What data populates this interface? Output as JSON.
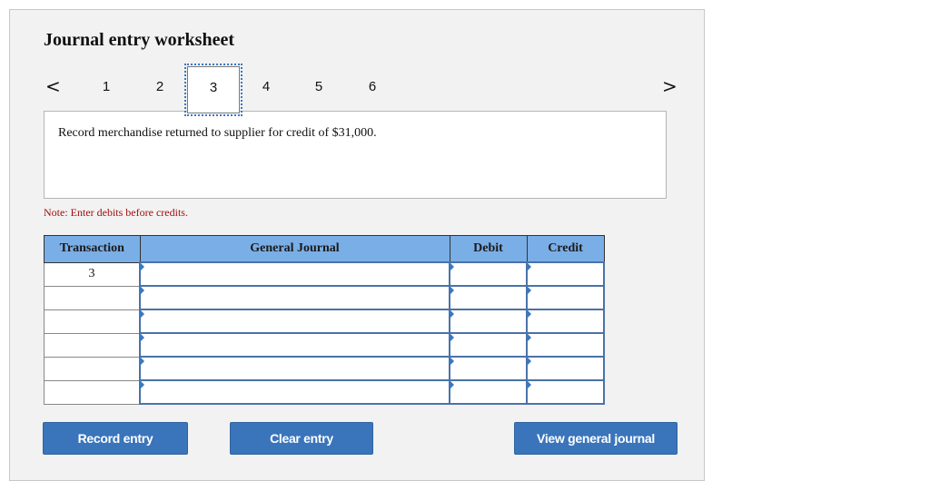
{
  "worksheet": {
    "title": "Journal entry worksheet",
    "nav": {
      "prev_icon": "‹",
      "next_icon": "›",
      "steps": [
        "1",
        "2",
        "3",
        "4",
        "5",
        "6"
      ],
      "active_step": "3"
    },
    "prompt": "Record merchandise returned to supplier for credit of $31,000.",
    "note": "Note: Enter debits before credits.",
    "table": {
      "headers": {
        "transaction": "Transaction",
        "general_journal": "General Journal",
        "debit": "Debit",
        "credit": "Credit"
      },
      "rows": [
        {
          "transaction": "3",
          "account": "",
          "debit": "",
          "credit": ""
        },
        {
          "transaction": "",
          "account": "",
          "debit": "",
          "credit": ""
        },
        {
          "transaction": "",
          "account": "",
          "debit": "",
          "credit": ""
        },
        {
          "transaction": "",
          "account": "",
          "debit": "",
          "credit": ""
        },
        {
          "transaction": "",
          "account": "",
          "debit": "",
          "credit": ""
        },
        {
          "transaction": "",
          "account": "",
          "debit": "",
          "credit": ""
        }
      ]
    },
    "buttons": {
      "record": "Record entry",
      "clear": "Clear entry",
      "view": "View general journal"
    },
    "colors": {
      "header_bg": "#7aaee6",
      "button_bg": "#3a75bb",
      "note_text": "#a10e0e",
      "active_step_outline": "#3a78c0"
    }
  }
}
